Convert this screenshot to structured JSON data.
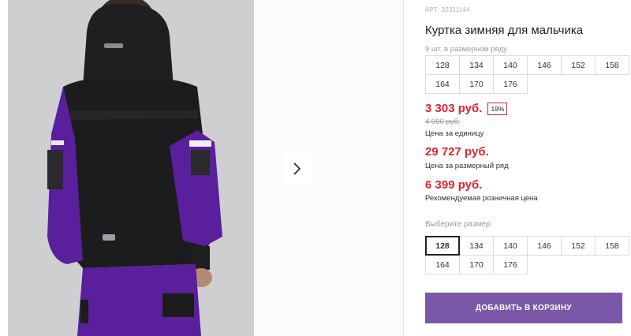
{
  "product": {
    "sku": "АРТ: 32311144",
    "title": "Куртка зимняя для мальчика",
    "pack_note": "9 шт. в размерном ряду"
  },
  "pack_sizes": [
    "128",
    "134",
    "140",
    "146",
    "152",
    "158",
    "164",
    "170",
    "176"
  ],
  "pricing": {
    "unit_price": "3 303 руб.",
    "discount": "19%",
    "old_price": "4 090 руб.",
    "unit_caption": "Цена за единицу",
    "pack_price": "29 727 руб.",
    "pack_caption": "Цена за размерный ряд",
    "rrp_price": "6 399 руб.",
    "rrp_caption": "Рекомендуемая розничная цена"
  },
  "size_selector": {
    "label": "Выберите размер:",
    "sizes": [
      "128",
      "134",
      "140",
      "146",
      "152",
      "158",
      "164",
      "170",
      "176"
    ],
    "selected": "128"
  },
  "cart": {
    "add_label": "ДОБАВИТЬ В КОРЗИНУ"
  },
  "colors": {
    "price_red": "#e0242d",
    "button_purple": "#7b57a8",
    "jacket_black": "#1c1c1e",
    "jacket_purple": "#5a1f9c"
  },
  "gallery": {
    "next_icon": "chevron-right-icon"
  }
}
